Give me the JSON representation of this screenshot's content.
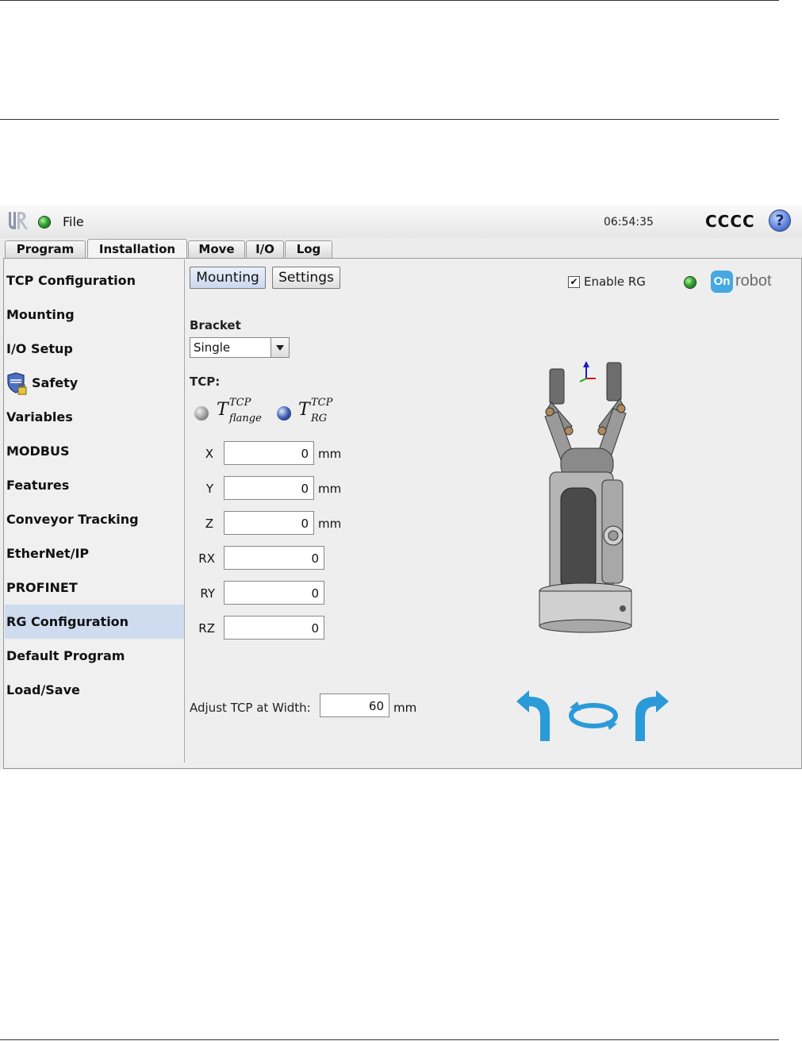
{
  "window": {
    "file_menu": "File",
    "clock": "06:54:35",
    "robot_name": "CCCC",
    "help": "?"
  },
  "tabs": [
    {
      "label": "Program",
      "active": false
    },
    {
      "label": "Installation",
      "active": true
    },
    {
      "label": "Move",
      "active": false
    },
    {
      "label": "I/O",
      "active": false
    },
    {
      "label": "Log",
      "active": false
    }
  ],
  "sidebar": {
    "items": [
      {
        "label": "TCP Configuration"
      },
      {
        "label": "Mounting"
      },
      {
        "label": "I/O Setup"
      },
      {
        "label": "Safety",
        "icon": "shield-lock-icon"
      },
      {
        "label": "Variables"
      },
      {
        "label": "MODBUS"
      },
      {
        "label": "Features"
      },
      {
        "label": "Conveyor Tracking"
      },
      {
        "label": "EtherNet/IP"
      },
      {
        "label": "PROFINET"
      },
      {
        "label": "RG Configuration",
        "selected": true
      },
      {
        "label": "Default Program"
      },
      {
        "label": "Load/Save"
      }
    ],
    "selected_color": "#cfdcf0"
  },
  "main": {
    "subtabs": [
      {
        "label": "Mounting",
        "active": true
      },
      {
        "label": "Settings",
        "active": false
      }
    ],
    "enable_rg": {
      "label": "Enable RG",
      "checked": true,
      "mark": "✔"
    },
    "status_color": "#33a433",
    "logo": {
      "mark": "On",
      "text": "robot"
    },
    "bracket": {
      "label": "Bracket",
      "value": "Single"
    },
    "tcp": {
      "label": "TCP:",
      "options": [
        {
          "base": "T",
          "sup": "TCP",
          "sub": "flange",
          "selected": false
        },
        {
          "base": "T",
          "sup": "TCP",
          "sub": "RG",
          "selected": true
        }
      ]
    },
    "fields": [
      {
        "label": "X",
        "value": "0",
        "unit": "mm"
      },
      {
        "label": "Y",
        "value": "0",
        "unit": "mm"
      },
      {
        "label": "Z",
        "value": "0",
        "unit": "mm"
      },
      {
        "label": "RX",
        "value": "0",
        "unit": ""
      },
      {
        "label": "RY",
        "value": "0",
        "unit": ""
      },
      {
        "label": "RZ",
        "value": "0",
        "unit": ""
      }
    ],
    "adjust_tcp": {
      "label": "Adjust TCP at Width:",
      "value": "60",
      "unit": "mm"
    },
    "gripper_image": "rg2-gripper-render",
    "rotate_buttons": [
      "rotate-left-icon",
      "rotate-cycle-icon",
      "rotate-right-icon"
    ],
    "accent_color": "#2a9ad8"
  }
}
